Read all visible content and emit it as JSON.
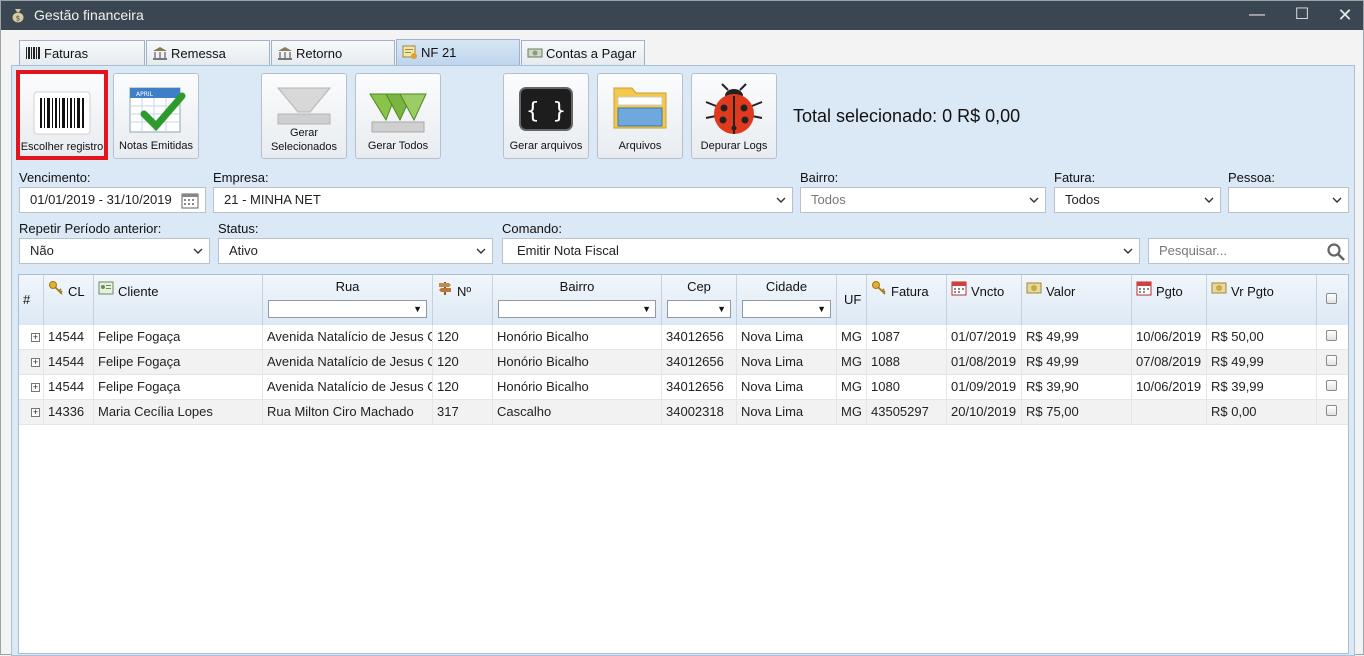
{
  "window": {
    "title": "Gestão financeira",
    "min": "—",
    "max": "☐",
    "close": "✕"
  },
  "tabs": [
    {
      "label": "Faturas",
      "icon": "barcode-icon"
    },
    {
      "label": "Remessa",
      "icon": "bank-icon"
    },
    {
      "label": "Retorno",
      "icon": "bank-icon"
    },
    {
      "label": "NF 21",
      "icon": "invoice-icon",
      "active": true
    },
    {
      "label": "Contas a Pagar",
      "icon": "money-icon"
    }
  ],
  "toolbar": {
    "escolher": "Escolher registro",
    "notas": "Notas Emitidas",
    "gerar_sel_1": "Gerar",
    "gerar_sel_2": "Selecionados",
    "gerar_todos": "Gerar Todos",
    "gerar_arquivos": "Gerar arquivos",
    "arquivos": "Arquivos",
    "depurar": "Depurar Logs",
    "total": "Total selecionado: 0 R$ 0,00"
  },
  "filters": {
    "vencimento_label": "Vencimento:",
    "vencimento_value": "01/01/2019 - 31/10/2019",
    "empresa_label": "Empresa:",
    "empresa_value": "21 - MINHA NET",
    "bairro_label": "Bairro:",
    "bairro_value": "Todos",
    "fatura_label": "Fatura:",
    "fatura_value": "Todos",
    "pessoa_label": "Pessoa:",
    "pessoa_value": "",
    "repetir_label": "Repetir Período anterior:",
    "repetir_value": "Não",
    "status_label": "Status:",
    "status_value": "Ativo",
    "comando_label": "Comando:",
    "comando_value": "Emitir Nota Fiscal",
    "search_placeholder": "Pesquisar..."
  },
  "grid": {
    "columns": {
      "hash": "#",
      "cl": "CL",
      "cliente": "Cliente",
      "rua": "Rua",
      "numero": "Nº",
      "bairro": "Bairro",
      "cep": "Cep",
      "cidade": "Cidade",
      "uf": "UF",
      "fatura": "Fatura",
      "vencto": "Vncto",
      "valor": "Valor",
      "pgto": "Pgto",
      "vr_pgto": "Vr Pgto"
    },
    "rows": [
      {
        "cl": "14544",
        "cliente": "Felipe Fogaça",
        "rua": "Avenida Natalício de Jesus Ca",
        "numero": "120",
        "bairro": "Honório Bicalho",
        "cep": "34012656",
        "cidade": "Nova Lima",
        "uf": "MG",
        "fatura": "1087",
        "vencto": "01/07/2019",
        "valor": "R$ 49,99",
        "pgto": "10/06/2019",
        "vr_pgto": "R$ 50,00"
      },
      {
        "cl": "14544",
        "cliente": "Felipe Fogaça",
        "rua": "Avenida Natalício de Jesus Ca",
        "numero": "120",
        "bairro": "Honório Bicalho",
        "cep": "34012656",
        "cidade": "Nova Lima",
        "uf": "MG",
        "fatura": "1088",
        "vencto": "01/08/2019",
        "valor": "R$ 49,99",
        "pgto": "07/08/2019",
        "vr_pgto": "R$ 49,99"
      },
      {
        "cl": "14544",
        "cliente": "Felipe Fogaça",
        "rua": "Avenida Natalício de Jesus Ca",
        "numero": "120",
        "bairro": "Honório Bicalho",
        "cep": "34012656",
        "cidade": "Nova Lima",
        "uf": "MG",
        "fatura": "1080",
        "vencto": "01/09/2019",
        "valor": "R$ 39,90",
        "pgto": "10/06/2019",
        "vr_pgto": "R$ 39,99"
      },
      {
        "cl": "14336",
        "cliente": "Maria Cecília Lopes",
        "rua": "Rua Milton Ciro Machado",
        "numero": "317",
        "bairro": "Cascalho",
        "cep": "34002318",
        "cidade": "Nova Lima",
        "uf": "MG",
        "fatura": "43505297",
        "vencto": "20/10/2019",
        "valor": "R$ 75,00",
        "pgto": "",
        "vr_pgto": "R$ 0,00"
      }
    ]
  }
}
